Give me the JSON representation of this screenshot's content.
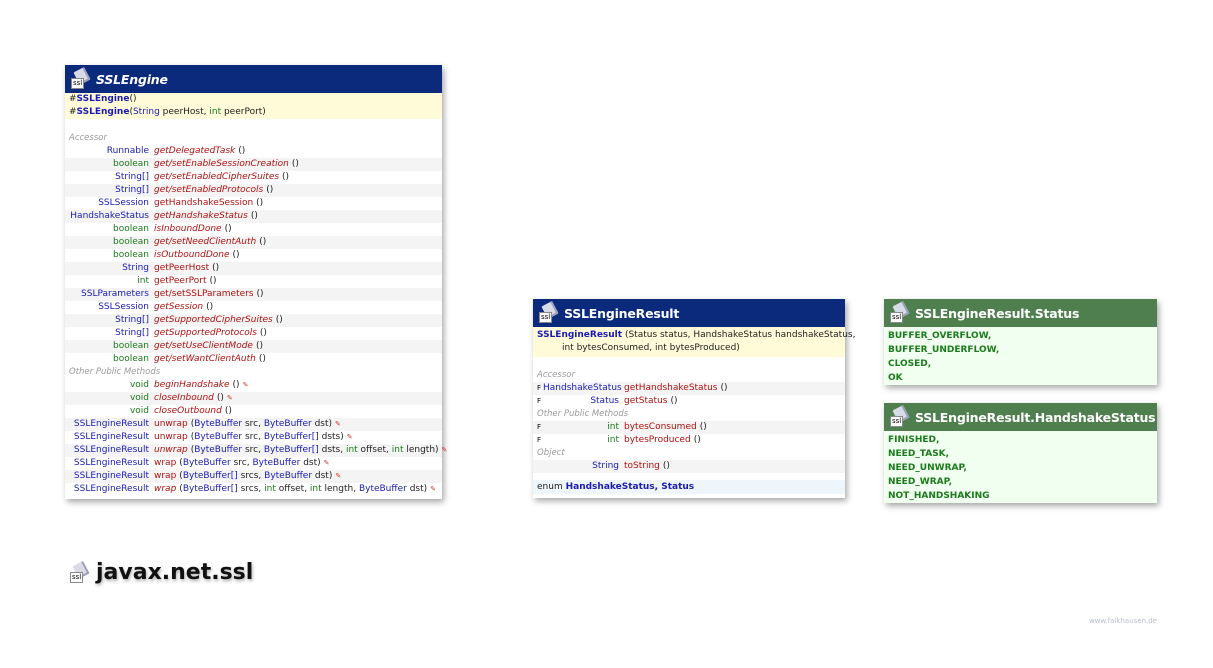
{
  "sslengine": {
    "title": "SSLEngine",
    "icon_label": "ssl",
    "constructors": [
      {
        "mark": "#",
        "name": "SSLEngine",
        "args": " ()"
      },
      {
        "mark": "#",
        "name": "SSLEngine",
        "args_parts": [
          " (",
          "String",
          " peerHost, ",
          "int",
          " peerPort)"
        ]
      }
    ],
    "section_accessor": "Accessor",
    "accessors": [
      {
        "type": "Runnable",
        "type_color": "blue",
        "name": "getDelegatedTask",
        "italic": true,
        "args": "()"
      },
      {
        "type": "boolean",
        "type_color": "green",
        "name": "get/setEnableSessionCreation",
        "italic": true,
        "args": "()"
      },
      {
        "type": "String[]",
        "type_color": "blue",
        "name": "get/setEnabledCipherSuites",
        "italic": true,
        "args": "()"
      },
      {
        "type": "String[]",
        "type_color": "blue",
        "name": "get/setEnabledProtocols",
        "italic": true,
        "args": "()"
      },
      {
        "type": "SSLSession",
        "type_color": "blue",
        "name": "getHandshakeSession",
        "italic": false,
        "args": "()"
      },
      {
        "type": "HandshakeStatus",
        "type_color": "blue",
        "name": "getHandshakeStatus",
        "italic": true,
        "args": "()"
      },
      {
        "type": "boolean",
        "type_color": "green",
        "name": "isInboundDone",
        "italic": true,
        "args": "()"
      },
      {
        "type": "boolean",
        "type_color": "green",
        "name": "get/setNeedClientAuth",
        "italic": true,
        "args": "()"
      },
      {
        "type": "boolean",
        "type_color": "green",
        "name": "isOutboundDone",
        "italic": true,
        "args": "()"
      },
      {
        "type": "String",
        "type_color": "blue",
        "name": "getPeerHost",
        "italic": false,
        "args": "()"
      },
      {
        "type": "int",
        "type_color": "green",
        "name": "getPeerPort",
        "italic": false,
        "args": "()"
      },
      {
        "type": "SSLParameters",
        "type_color": "blue",
        "name": "get/setSSLParameters",
        "italic": false,
        "args": "()"
      },
      {
        "type": "SSLSession",
        "type_color": "blue",
        "name": "getSession",
        "italic": true,
        "args": "()"
      },
      {
        "type": "String[]",
        "type_color": "blue",
        "name": "getSupportedCipherSuites",
        "italic": true,
        "args": "()"
      },
      {
        "type": "String[]",
        "type_color": "blue",
        "name": "getSupportedProtocols",
        "italic": true,
        "args": "()"
      },
      {
        "type": "boolean",
        "type_color": "green",
        "name": "get/setUseClientMode",
        "italic": true,
        "args": "()"
      },
      {
        "type": "boolean",
        "type_color": "green",
        "name": "get/setWantClientAuth",
        "italic": true,
        "args": "()"
      }
    ],
    "section_other": "Other Public Methods",
    "methods": [
      {
        "type": "void",
        "type_color": "green",
        "name": "beginHandshake",
        "italic": true,
        "args": "()",
        "warn": true
      },
      {
        "type": "void",
        "type_color": "green",
        "name": "closeInbound",
        "italic": true,
        "args": "()",
        "warn": true
      },
      {
        "type": "void",
        "type_color": "green",
        "name": "closeOutbound",
        "italic": true,
        "args": "()",
        "warn": false
      },
      {
        "type": "SSLEngineResult",
        "type_color": "blue",
        "name": "unwrap",
        "italic": false,
        "args": "(ByteBuffer src, ByteBuffer dst)",
        "warn": true
      },
      {
        "type": "SSLEngineResult",
        "type_color": "blue",
        "name": "unwrap",
        "italic": false,
        "args": "(ByteBuffer src, ByteBuffer[] dsts)",
        "warn": true
      },
      {
        "type": "SSLEngineResult",
        "type_color": "blue",
        "name": "unwrap",
        "italic": true,
        "args": "(ByteBuffer src, ByteBuffer[] dsts, int offset, int length)",
        "warn": true
      },
      {
        "type": "SSLEngineResult",
        "type_color": "blue",
        "name": "wrap",
        "italic": false,
        "args": "(ByteBuffer src, ByteBuffer dst)",
        "warn": true
      },
      {
        "type": "SSLEngineResult",
        "type_color": "blue",
        "name": "wrap",
        "italic": false,
        "args": "(ByteBuffer[] srcs, ByteBuffer dst)",
        "warn": true
      },
      {
        "type": "SSLEngineResult",
        "type_color": "blue",
        "name": "wrap",
        "italic": true,
        "args": "(ByteBuffer[] srcs, int offset, int length, ByteBuffer dst)",
        "warn": true
      }
    ]
  },
  "sslengineresult": {
    "title": "SSLEngineResult",
    "icon_label": "ssl",
    "ctor_name": "SSLEngineResult",
    "ctor_line1": " (Status status, HandshakeStatus handshakeStatus,",
    "ctor_line2": "int bytesConsumed, int bytesProduced)",
    "section_accessor": "Accessor",
    "accessors": [
      {
        "mark": "F",
        "type": "HandshakeStatus",
        "type_color": "blue",
        "name": "getHandshakeStatus",
        "args": "()"
      },
      {
        "mark": "F",
        "type": "Status",
        "type_color": "blue",
        "name": "getStatus",
        "args": "()"
      }
    ],
    "section_other": "Other Public Methods",
    "methods": [
      {
        "mark": "F",
        "type": "int",
        "type_color": "green",
        "name": "bytesConsumed",
        "args": "()"
      },
      {
        "mark": "F",
        "type": "int",
        "type_color": "green",
        "name": "bytesProduced",
        "args": "()"
      }
    ],
    "section_object": "Object",
    "object_methods": [
      {
        "mark": "",
        "type": "String",
        "type_color": "blue",
        "name": "toString",
        "args": "()"
      }
    ],
    "enum_prefix": "enum",
    "enum_names": "HandshakeStatus, Status"
  },
  "status": {
    "title": "SSLEngineResult.Status",
    "icon_label": "ssl",
    "constants": [
      "BUFFER_OVERFLOW,",
      "BUFFER_UNDERFLOW,",
      "CLOSED,",
      "OK"
    ]
  },
  "handshake": {
    "title": "SSLEngineResult.HandshakeStatus",
    "icon_label": "ssl",
    "constants": [
      "FINISHED,",
      "NEED_TASK,",
      "NEED_UNWRAP,",
      "NEED_WRAP,",
      "NOT_HANDSHAKING"
    ]
  },
  "package": {
    "name": "javax.net.ssl",
    "icon_label": "ssl"
  },
  "credit": "www.falkhausen.de",
  "colors": {
    "header_blue": "#0b2a7c",
    "header_green": "#4f7f4f",
    "ctor_bg": "#fffbd8",
    "type_blue": "#1a1ab4",
    "type_green": "#1b7a1b",
    "method_red": "#b01010"
  }
}
